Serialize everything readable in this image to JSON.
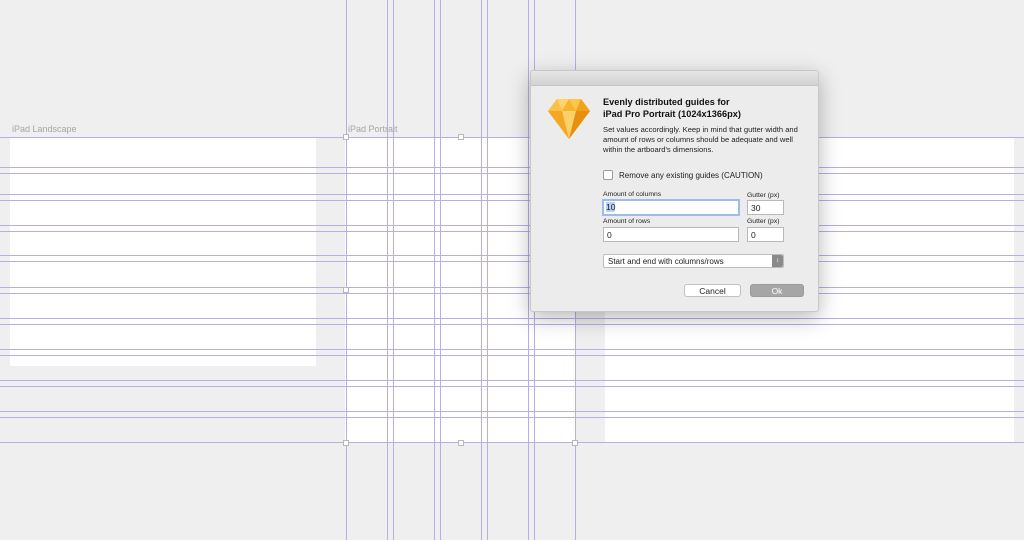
{
  "artboards": {
    "landscape_label": "iPad Landscape",
    "portrait_label": "iPad Portrait"
  },
  "dialog": {
    "icon": "sketch-diamond-icon",
    "title_line1": "Evenly distributed guides for",
    "title_line2": "iPad Pro Portrait (1024x1366px)",
    "description": "Set values accordingly. Keep in mind that gutter width and amount of rows or columns should be adequate and well within the artboard's dimensions.",
    "remove_guides_label": "Remove any existing guides (CAUTION)",
    "remove_guides_checked": false,
    "columns_label": "Amount of columns",
    "columns_value": "10",
    "columns_gutter_label": "Gutter (px)",
    "columns_gutter_value": "30",
    "rows_label": "Amount of rows",
    "rows_value": "0",
    "rows_gutter_label": "Gutter (px)",
    "rows_gutter_value": "0",
    "mode_selected": "Start and end with columns/rows",
    "cancel_label": "Cancel",
    "ok_label": "Ok"
  },
  "colors": {
    "guide": "#b7aee4",
    "canvas": "#efefef",
    "artboard": "#ffffff"
  }
}
